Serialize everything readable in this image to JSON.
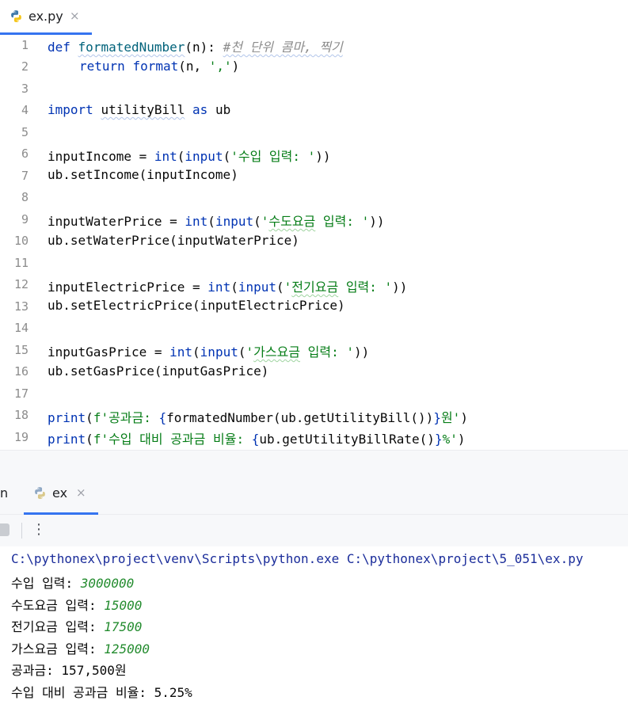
{
  "editor_tab": {
    "filename": "ex.py",
    "close": "×"
  },
  "code_lines": [
    {
      "n": "1"
    },
    {
      "n": "2"
    },
    {
      "n": "3"
    },
    {
      "n": "4"
    },
    {
      "n": "5"
    },
    {
      "n": "6"
    },
    {
      "n": "7"
    },
    {
      "n": "8"
    },
    {
      "n": "9"
    },
    {
      "n": "10"
    },
    {
      "n": "11"
    },
    {
      "n": "12"
    },
    {
      "n": "13"
    },
    {
      "n": "14"
    },
    {
      "n": "15"
    },
    {
      "n": "16"
    },
    {
      "n": "17"
    },
    {
      "n": "18"
    },
    {
      "n": "19"
    }
  ],
  "code": {
    "l1_def": "def",
    "l1_name": "formatedNumber",
    "l1_rest": "(n):",
    "l1_comment": "#천 단위 콤마, 찍기",
    "l2_return": "return",
    "l2_fn": "format",
    "l2_a": "(n, ",
    "l2_str": "','",
    "l2_b": ")",
    "l4_import": "import",
    "l4_mod": "utilityBill",
    "l4_as": "as",
    "l4_alias": "ub",
    "l6_var": "inputIncome = ",
    "l6_int": "int",
    "l6_p": "(",
    "l6_input": "input",
    "l6_p2": "(",
    "l6_str": "'수입 입력: '",
    "l6_end": "))",
    "l7": "ub.setIncome(inputIncome)",
    "l9_var": "inputWaterPrice = ",
    "l9_int": "int",
    "l9_p": "(",
    "l9_input": "input",
    "l9_p2": "(",
    "l9_str_a": "'",
    "l9_str_w": "수도요금",
    "l9_str_b": " 입력: '",
    "l9_end": "))",
    "l10": "ub.setWaterPrice(inputWaterPrice)",
    "l12_var": "inputElectricPrice = ",
    "l12_int": "int",
    "l12_p": "(",
    "l12_input": "input",
    "l12_p2": "(",
    "l12_str_a": "'",
    "l12_str_w": "전기요금",
    "l12_str_b": " 입력: '",
    "l12_end": "))",
    "l13": "ub.setElectricPrice(inputElectricPrice)",
    "l15_var": "inputGasPrice = ",
    "l15_int": "int",
    "l15_p": "(",
    "l15_input": "input",
    "l15_p2": "(",
    "l15_str_a": "'",
    "l15_str_w": "가스요금",
    "l15_str_b": " 입력: '",
    "l15_end": "))",
    "l16": "ub.setGasPrice(inputGasPrice)",
    "l18_print": "print",
    "l18_p": "(",
    "l18_str_a": "f'공과금: ",
    "l18_brace_a": "{",
    "l18_expr": "formatedNumber(ub.getUtilityBill())",
    "l18_brace_b": "}",
    "l18_str_b": "원'",
    "l18_end": ")",
    "l19_print": "print",
    "l19_p": "(",
    "l19_str_a": "f'수입 대비 공과금 비율: ",
    "l19_brace_a": "{",
    "l19_expr": "ub.getUtilityBillRate()",
    "l19_brace_b": "}",
    "l19_str_b": "%'",
    "l19_end": ")"
  },
  "run_panel": {
    "partial_tab": "n",
    "tab_label": "ex",
    "close": "×",
    "more": "⋮"
  },
  "console": {
    "command": "C:\\pythonex\\project\\venv\\Scripts\\python.exe C:\\pythonex\\project\\5_051\\ex.py",
    "p1": "수입 입력: ",
    "v1": "3000000",
    "p2": "수도요금 입력: ",
    "v2": "15000",
    "p3": "전기요금 입력: ",
    "v3": "17500",
    "p4": "가스요금 입력: ",
    "v4": "125000",
    "out1": "공과금: 157,500원",
    "out2": "수입 대비 공과금 비율: 5.25%"
  },
  "colors": {
    "keyword": "#0033b3",
    "function": "#00627a",
    "string": "#067d17",
    "comment": "#8c8c8c",
    "accent": "#3574f0",
    "console_input": "#248c2f",
    "console_path": "#1a2c9a"
  }
}
